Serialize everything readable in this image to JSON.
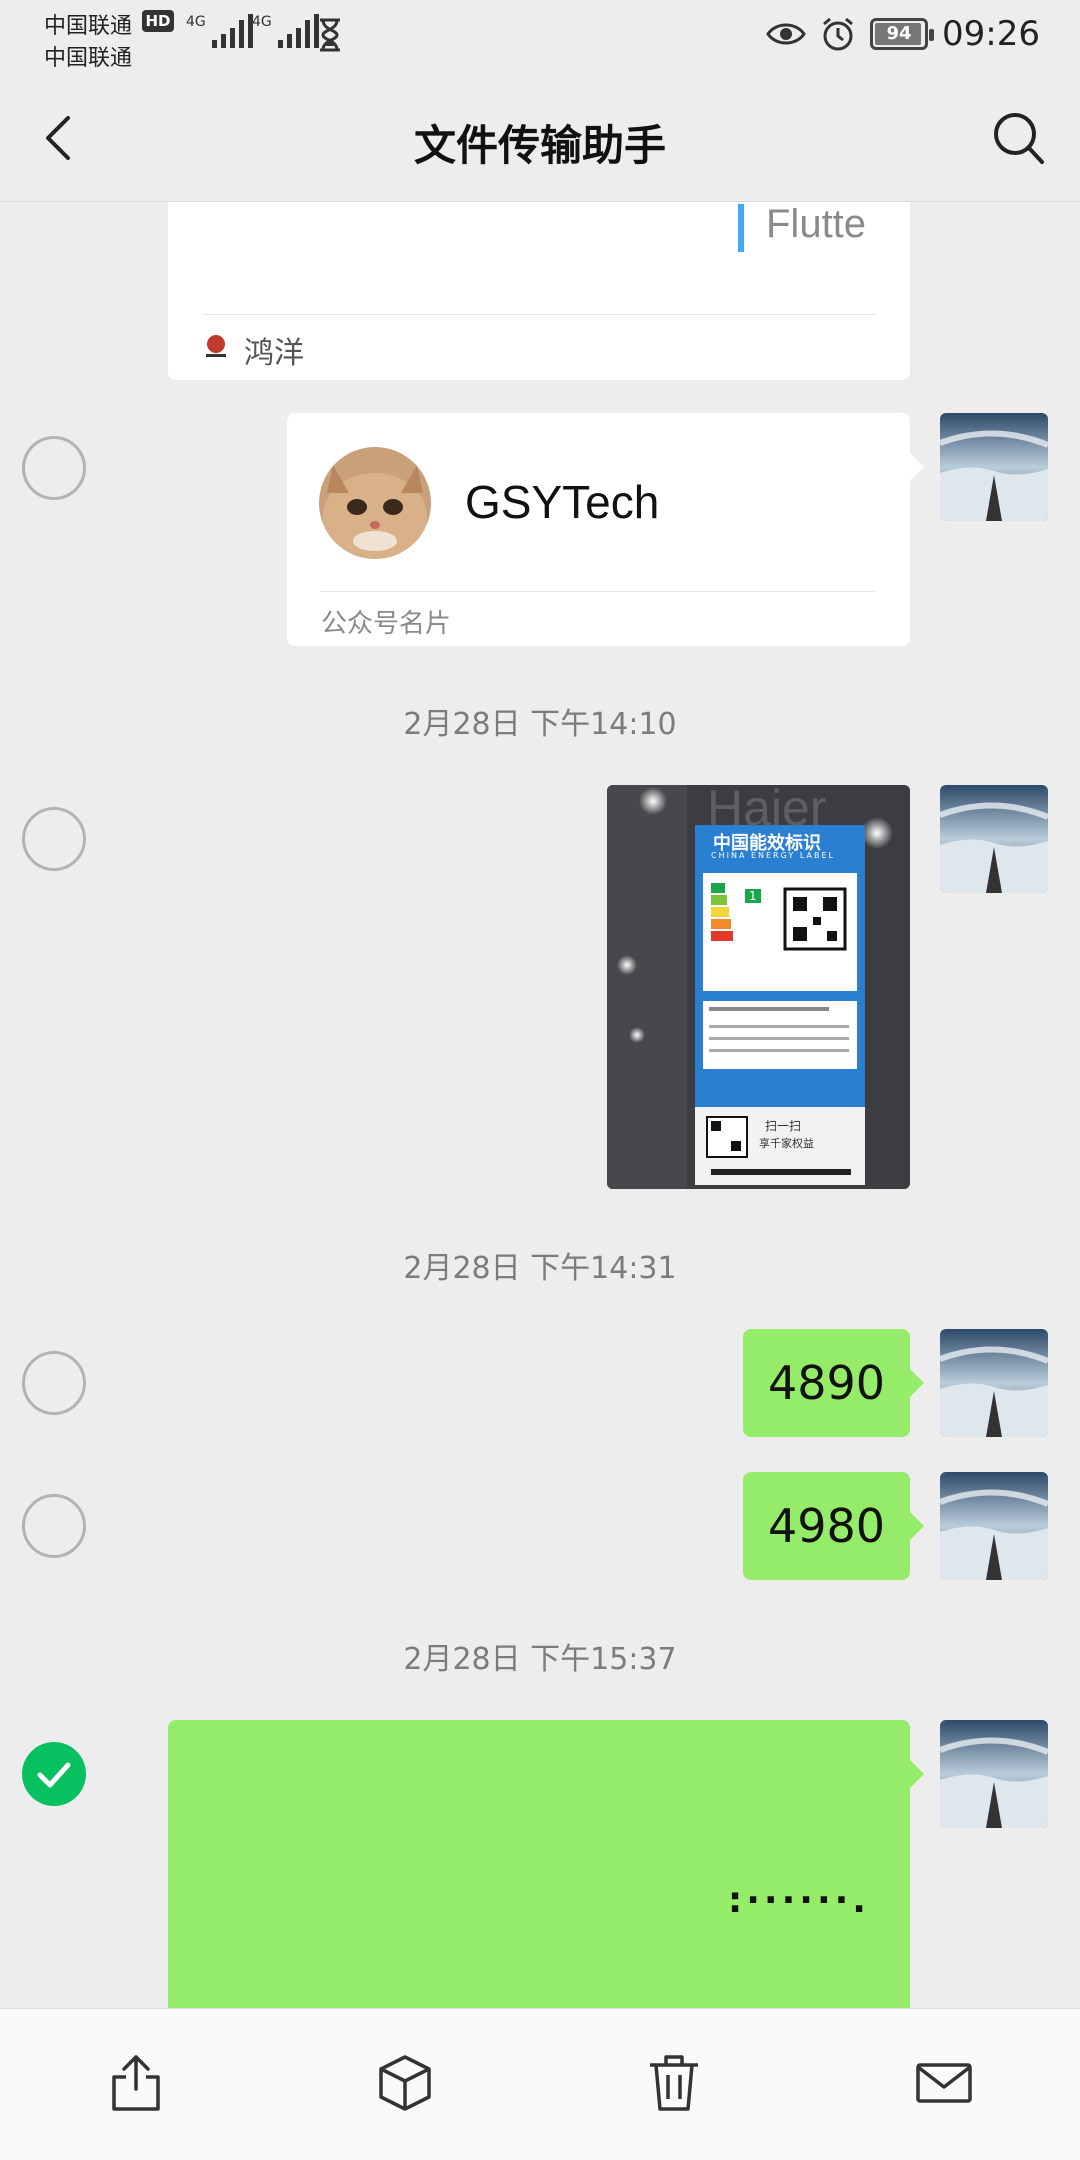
{
  "status_bar": {
    "carrier_1": "中国联通",
    "carrier_2": "中国联通",
    "hd_badge": "HD",
    "network_1": "4G",
    "network_2": "4G",
    "battery_level": "94",
    "time": "09:26"
  },
  "header": {
    "title": "文件传输助手",
    "back_icon": "chevron-left-icon",
    "search_icon": "search-icon"
  },
  "messages": {
    "article_card": {
      "preview_text": "Flutte",
      "source_name": "鸿洋"
    },
    "contact_card": {
      "name": "GSYTech",
      "card_type": "公众号名片"
    },
    "timestamp_1": "2月28日 下午14:10",
    "image_message": {
      "label_title": "中国能效标识",
      "label_subtitle": "CHINA ENERGY LABEL",
      "grade": "1",
      "scan_text": "扫一扫",
      "rights_text": "享千家权益",
      "brand_text": "Haier"
    },
    "timestamp_2": "2月28日 下午14:31",
    "text_1": "4890",
    "text_2": "4980",
    "timestamp_3": "2月28日 下午15:37",
    "selected_message_text": ":······.",
    "selected": true
  },
  "toolbar": {
    "icons": [
      "share-icon",
      "cube-icon",
      "trash-icon",
      "mail-icon"
    ]
  },
  "colors": {
    "background": "#ededed",
    "bubble_green": "#95ec69",
    "check_green": "#07c160"
  }
}
